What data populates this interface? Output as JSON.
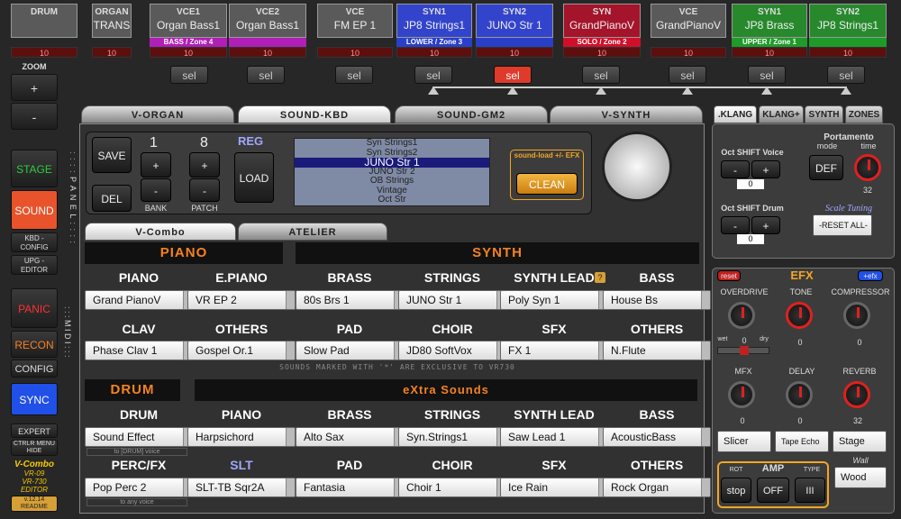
{
  "slots": [
    {
      "cat": "DRUM",
      "name": "",
      "zone": "",
      "zone_color": "",
      "val": "10"
    },
    {
      "cat": "ORGAN",
      "name": "TRANS",
      "zone": "",
      "zone_color": "",
      "val": "10"
    },
    {
      "cat": "VCE1",
      "name": "Organ Bass1",
      "zone": "BASS / Zone 4",
      "zone_color": "#b01fb6",
      "val": "10"
    },
    {
      "cat": "VCE2",
      "name": "Organ Bass1",
      "zone": "",
      "zone_color": "#b01fb6",
      "val": "10"
    },
    {
      "cat": "VCE",
      "name": "FM EP 1",
      "zone": "",
      "zone_color": "",
      "val": "10"
    },
    {
      "cat": "SYN1",
      "name": "JP8 Strings1",
      "zone": "LOWER / Zone 3",
      "zone_color": "#2a3fc8",
      "val": "10"
    },
    {
      "cat": "SYN2",
      "name": "JUNO Str 1",
      "zone": "",
      "zone_color": "#2a3fc8",
      "val": "10"
    },
    {
      "cat": "SYN",
      "name": "GrandPianoV",
      "zone": "SOLO / Zone 2",
      "zone_color": "#d0102b",
      "val": "10"
    },
    {
      "cat": "VCE",
      "name": "GrandPianoV",
      "zone": "",
      "zone_color": "",
      "val": "10"
    },
    {
      "cat": "SYN1",
      "name": "JP8 Brass",
      "zone": "UPPER / Zone 1",
      "zone_color": "#1f9b2a",
      "val": "10"
    },
    {
      "cat": "SYN2",
      "name": "JP8 Strings1",
      "zone": "",
      "zone_color": "#1f9b2a",
      "val": "10"
    }
  ],
  "sel_label": "sel",
  "left": {
    "zoom": "ZOOM",
    "plus": "+",
    "minus": "-",
    "stage": "STAGE",
    "sound": "SOUND",
    "kbd_config": "KBD - CONFIG",
    "upg_editor": "UPG - EDITOR",
    "panel": ": : : : P A N E L : : : :",
    "panic": "PANIC",
    "recon": "RECON",
    "config": "CONFIG",
    "midi": ": : : M I D I : : :",
    "sync": "SYNC",
    "expert": "EXPERT",
    "ctrlr": "CTRLR MENU HIDE",
    "logo1": "V-Combo",
    "logo2": "VR-09",
    "logo3": "VR-730",
    "logo4": "EDITOR",
    "version": "v.12.14 README"
  },
  "tabs": [
    "V-ORGAN",
    "SOUND-KBD",
    "SOUND-GM2",
    "V-SYNTH"
  ],
  "right_tabs": [
    ".KLANG",
    "KLANG+",
    "SYNTH",
    "ZONES"
  ],
  "top": {
    "save": "SAVE",
    "del": "DEL",
    "n1": "1",
    "n2": "8",
    "bank": "BANK",
    "patch": "PATCH",
    "reg": "REG",
    "load": "LOAD",
    "sound_load": "sound-load +/- EFX",
    "clean": "CLEAN"
  },
  "patchlist": [
    "Syn Strings1",
    "Syn Strings2",
    "JUNO Str 1",
    "JUNO Str 2",
    "OB Strings",
    "Vintage",
    "Oct Str"
  ],
  "subtabs": [
    "V-Combo",
    "ATELIER"
  ],
  "piano_hdr": "PIANO",
  "synth_hdr": "SYNTH",
  "row1": [
    {
      "c": "PIANO",
      "v": "Grand PianoV"
    },
    {
      "c": "E.PIANO",
      "v": "VR EP 2"
    },
    {
      "c": "BRASS",
      "v": "80s Brs 1"
    },
    {
      "c": "STRINGS",
      "v": "JUNO Str 1"
    },
    {
      "c": "SYNTH LEAD",
      "v": "Poly Syn 1"
    },
    {
      "c": "BASS",
      "v": "House Bs"
    }
  ],
  "row2": [
    {
      "c": "CLAV",
      "v": "Phase Clav 1"
    },
    {
      "c": "OTHERS",
      "v": "Gospel Or.1"
    },
    {
      "c": "PAD",
      "v": "Slow Pad"
    },
    {
      "c": "CHOIR",
      "v": "JD80 SoftVox"
    },
    {
      "c": "SFX",
      "v": "FX 1"
    },
    {
      "c": "OTHERS",
      "v": "N.Flute"
    }
  ],
  "excl_note": "SOUNDS MARKED WITH '*' ARE EXCLUSIVE TO VR730",
  "drum_hdr": "DRUM",
  "extra_hdr": "eXtra Sounds",
  "row3": [
    {
      "c": "DRUM",
      "v": "Sound Effect"
    },
    {
      "c": "PIANO",
      "v": "Harpsichord"
    },
    {
      "c": "BRASS",
      "v": "Alto Sax"
    },
    {
      "c": "STRINGS",
      "v": "Syn.Strings1"
    },
    {
      "c": "SYNTH LEAD",
      "v": "Saw Lead 1"
    },
    {
      "c": "BASS",
      "v": "AcousticBass"
    }
  ],
  "row4": [
    {
      "c": "PERC/FX",
      "v": "Pop Perc 2"
    },
    {
      "c": "SLT",
      "v": "SLT-TB Sqr2A"
    },
    {
      "c": "PAD",
      "v": "Fantasia"
    },
    {
      "c": "CHOIR",
      "v": "Choir 1"
    },
    {
      "c": "SFX",
      "v": "Ice Rain"
    },
    {
      "c": "OTHERS",
      "v": "Rock Organ"
    }
  ],
  "to_drum": "to [DRUM] voice",
  "to_any": "to any voice",
  "q": "?",
  "klang": {
    "oct_voice": "Oct SHIFT Voice",
    "oct_drum": "Oct SHIFT Drum",
    "minus": "-",
    "plus": "+",
    "zero": "0",
    "portamento": "Portamento",
    "mode": "mode",
    "time": "time",
    "def": "DEF",
    "port_val": "32",
    "scale": "Scale Tuning",
    "reset": "-RESET ALL-"
  },
  "efx": {
    "title": "EFX",
    "reset": "reset",
    "plus_efx": "+efx",
    "overdrive": "OVERDRIVE",
    "tone": "TONE",
    "compressor": "COMPRESSOR",
    "wet": "wet",
    "dry": "dry",
    "v1": "0",
    "v2": "0",
    "v3": "0",
    "v4": "0",
    "mfx": "MFX",
    "delay": "DELAY",
    "reverb": "REVERB",
    "m1": "0",
    "m2": "0",
    "m3": "32",
    "slicer": "Slicer",
    "tape": "Tape Echo",
    "stage": "Stage",
    "amp": "AMP",
    "rot": "ROT",
    "type": "TYPE",
    "stop": "stop",
    "off": "OFF",
    "iii": "III",
    "wall": "Wall",
    "wood": "Wood"
  }
}
